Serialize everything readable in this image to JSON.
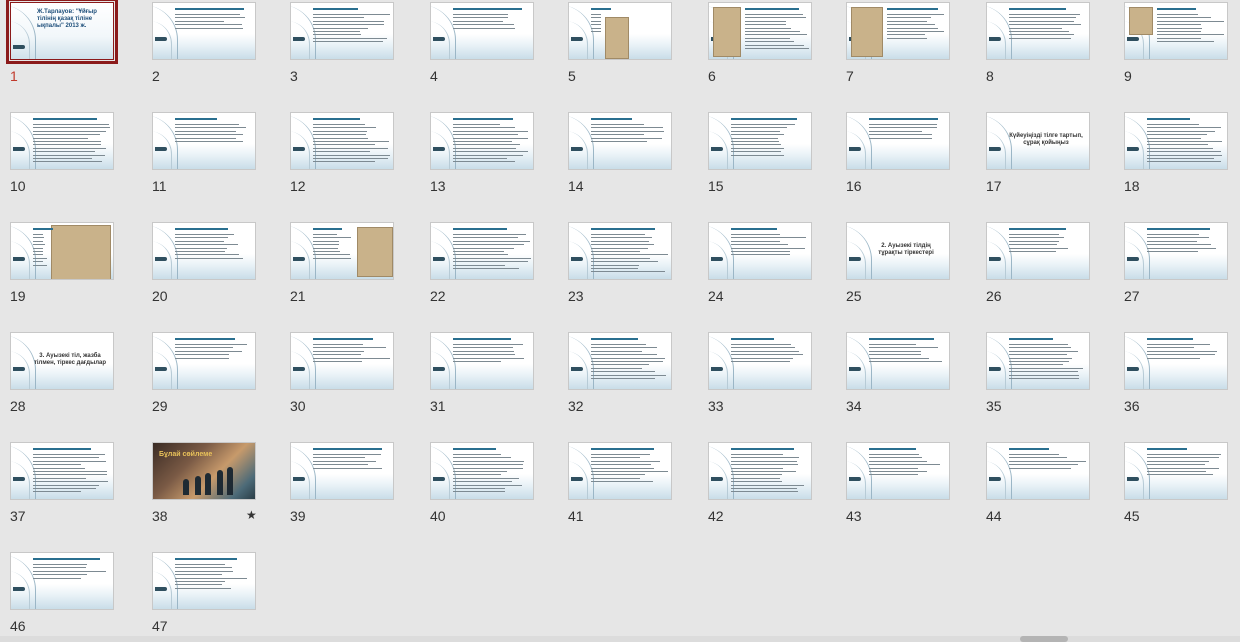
{
  "slides": [
    {
      "num": "1",
      "selected": true,
      "title": "Ж.Тарлауов: \"Ұйғыр тілінің қазақ тіліне ықпалы\" 2013 ж."
    },
    {
      "num": "2"
    },
    {
      "num": "3"
    },
    {
      "num": "4"
    },
    {
      "num": "5"
    },
    {
      "num": "6"
    },
    {
      "num": "7"
    },
    {
      "num": "8"
    },
    {
      "num": "9"
    },
    {
      "num": "10"
    },
    {
      "num": "11"
    },
    {
      "num": "12"
    },
    {
      "num": "13"
    },
    {
      "num": "14"
    },
    {
      "num": "15"
    },
    {
      "num": "16"
    },
    {
      "num": "17",
      "title": "Күйеуіңізді тілге тартып, сұрақ қойыңыз"
    },
    {
      "num": "18"
    },
    {
      "num": "19"
    },
    {
      "num": "20"
    },
    {
      "num": "21"
    },
    {
      "num": "22"
    },
    {
      "num": "23"
    },
    {
      "num": "24"
    },
    {
      "num": "25",
      "title": "2. Ауызекі тілдің тұрақты тіркестері"
    },
    {
      "num": "26"
    },
    {
      "num": "27"
    },
    {
      "num": "28",
      "title": "3. Ауызекі тіл, жазба тілмен, тіркес дағдылар"
    },
    {
      "num": "29"
    },
    {
      "num": "30"
    },
    {
      "num": "31"
    },
    {
      "num": "32"
    },
    {
      "num": "33"
    },
    {
      "num": "34"
    },
    {
      "num": "35"
    },
    {
      "num": "36"
    },
    {
      "num": "37"
    },
    {
      "num": "38",
      "star": "★",
      "photo_text": "Бұлай сөйлеме"
    },
    {
      "num": "39"
    },
    {
      "num": "40"
    },
    {
      "num": "41"
    },
    {
      "num": "42"
    },
    {
      "num": "43"
    },
    {
      "num": "44"
    },
    {
      "num": "45"
    },
    {
      "num": "46"
    },
    {
      "num": "47"
    }
  ]
}
